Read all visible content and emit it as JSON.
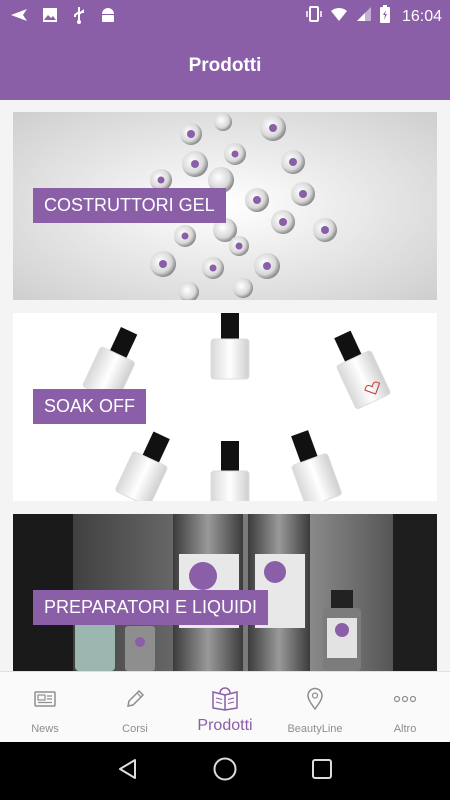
{
  "status_bar": {
    "time": "16:04",
    "left_icons": [
      "send-icon",
      "image-icon",
      "usb-icon",
      "android-icon"
    ],
    "right_icons": [
      "vibrate-icon",
      "wifi-icon",
      "signal-icon",
      "battery-icon"
    ]
  },
  "header": {
    "title": "Prodotti"
  },
  "categories": [
    {
      "label": "COSTRUTTORI GEL"
    },
    {
      "label": "SOAK OFF"
    },
    {
      "label": "PREPARATORI E LIQUIDI"
    }
  ],
  "bottom_nav": {
    "items": [
      {
        "label": "News",
        "icon": "newspaper-icon",
        "active": false
      },
      {
        "label": "Corsi",
        "icon": "pencil-icon",
        "active": false
      },
      {
        "label": "Prodotti",
        "icon": "book-icon",
        "active": true
      },
      {
        "label": "BeautyLine",
        "icon": "location-pin-icon",
        "active": false
      },
      {
        "label": "Altro",
        "icon": "more-icon",
        "active": false
      }
    ]
  },
  "system_nav": {
    "buttons": [
      "back-icon",
      "home-icon",
      "recents-icon"
    ]
  },
  "colors": {
    "primary": "#8a5fa8",
    "inactive": "#8e8e8e",
    "background": "#f4f4f4"
  }
}
